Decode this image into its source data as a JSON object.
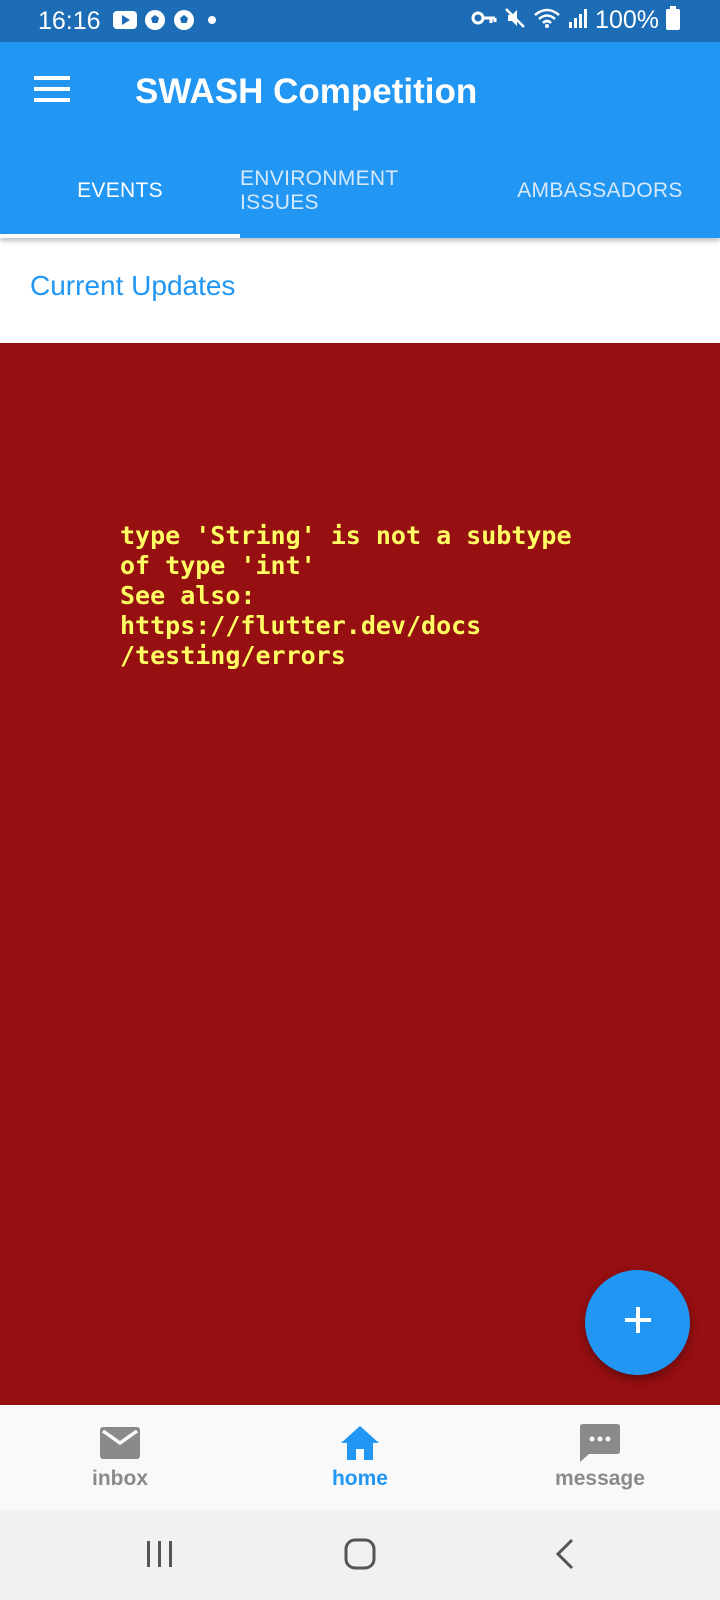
{
  "status_bar": {
    "time": "16:16",
    "battery": "100%",
    "notification_icons": [
      "youtube-icon",
      "soccer-ball-icon",
      "soccer-ball-icon",
      "dot-icon"
    ],
    "system_icons": [
      "key-icon",
      "mute-icon",
      "wifi-icon",
      "signal-icon",
      "battery-icon"
    ]
  },
  "app_bar": {
    "title": "SWASH Competition",
    "color": "#2196f3"
  },
  "tabs": [
    {
      "label": "EVENTS",
      "active": true
    },
    {
      "label": "ENVIRONMENT ISSUES",
      "active": false
    },
    {
      "label": "AMBASSADORS",
      "active": false
    }
  ],
  "section": {
    "title": "Current Updates"
  },
  "error": {
    "message": "type 'String' is not a subtype\nof type 'int'\nSee also:\nhttps://flutter.dev/docs\n/testing/errors",
    "background": "#960f11",
    "text_color": "#ffff63"
  },
  "fab": {
    "icon": "plus-icon"
  },
  "bottom_nav": [
    {
      "label": "inbox",
      "icon": "mail-icon",
      "active": false
    },
    {
      "label": "home",
      "icon": "home-icon",
      "active": true
    },
    {
      "label": "message",
      "icon": "chat-icon",
      "active": false
    }
  ],
  "system_nav": [
    "recents-icon",
    "home-circle-icon",
    "back-icon"
  ]
}
